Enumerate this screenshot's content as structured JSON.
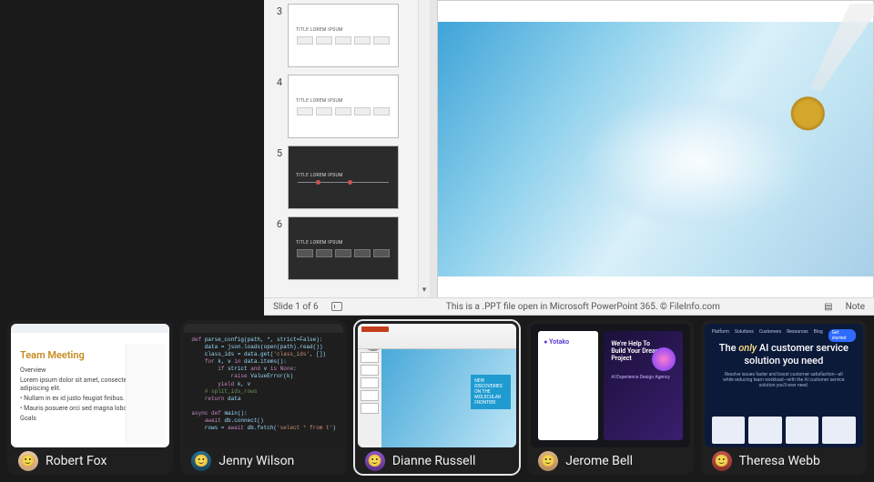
{
  "shared": {
    "slide_counter": "Slide 1 of 6",
    "footer_note": "This is a .PPT file open in Microsoft PowerPoint 365. © FileInfo.com",
    "notes_label": "Note",
    "thumbs": [
      {
        "num": "3",
        "title": "TITLE LOREM IPSUM",
        "variant": "light-grid"
      },
      {
        "num": "4",
        "title": "TITLE LOREM IPSUM",
        "variant": "light-grid"
      },
      {
        "num": "5",
        "title": "TITLE LOREM IPSUM",
        "variant": "dark-timeline"
      },
      {
        "num": "6",
        "title": "TITLE LOREM IPSUM",
        "variant": "dark-grid"
      }
    ]
  },
  "participants": [
    {
      "name": "Robert Fox",
      "avatar": "av1",
      "preview": {
        "kind": "doc",
        "heading": "Team Meeting",
        "lines": [
          "Overview",
          "Lorem ipsum dolor sit amet, consectetur adipiscing elit.",
          "• Nullam in ex id justo feugiat finibus.",
          "• Mauris posuere orci sed magna lobortis.",
          "Goals"
        ]
      }
    },
    {
      "name": "Jenny Wilson",
      "avatar": "av2",
      "preview": {
        "kind": "code",
        "text": "def parse_config(path, *, strict=False):\n    data = json.loads(open(path).read())\n    class_ids = data.get('class_ids', [])\n    for k, v in data.items():\n        if strict and v is None:\n            raise ValueError(k)\n        yield k, v\n    # split_ids_rows\n    return data\n\nasync def main():\n    await db.connect()\n    rows = await db.fetch('select * from t')"
      }
    },
    {
      "name": "Dianne Russell",
      "avatar": "av3",
      "active": true,
      "starred": true,
      "preview": {
        "kind": "ppt",
        "caption": "NEW DISCOVERIES ON THE MOLECULAR FRONTIER"
      }
    },
    {
      "name": "Jerome Bell",
      "avatar": "av4",
      "preview": {
        "kind": "web",
        "logo": "Yotako",
        "hero": "We're Help To Build Your Dream Project",
        "sub": "AI Experience Design Agency"
      }
    },
    {
      "name": "Theresa Webb",
      "avatar": "av5",
      "preview": {
        "kind": "ai",
        "nav": [
          "Platform",
          "Solutions",
          "Customers",
          "Resources",
          "Blog"
        ],
        "nav_btn": "Get started",
        "headline_pre": "The ",
        "headline_em": "only",
        "headline_post": " AI customer service solution you need",
        "sub": "Resolve issues faster and boost customer satisfaction—all while reducing team workload—with the AI customer service solution you'll ever need."
      }
    }
  ]
}
